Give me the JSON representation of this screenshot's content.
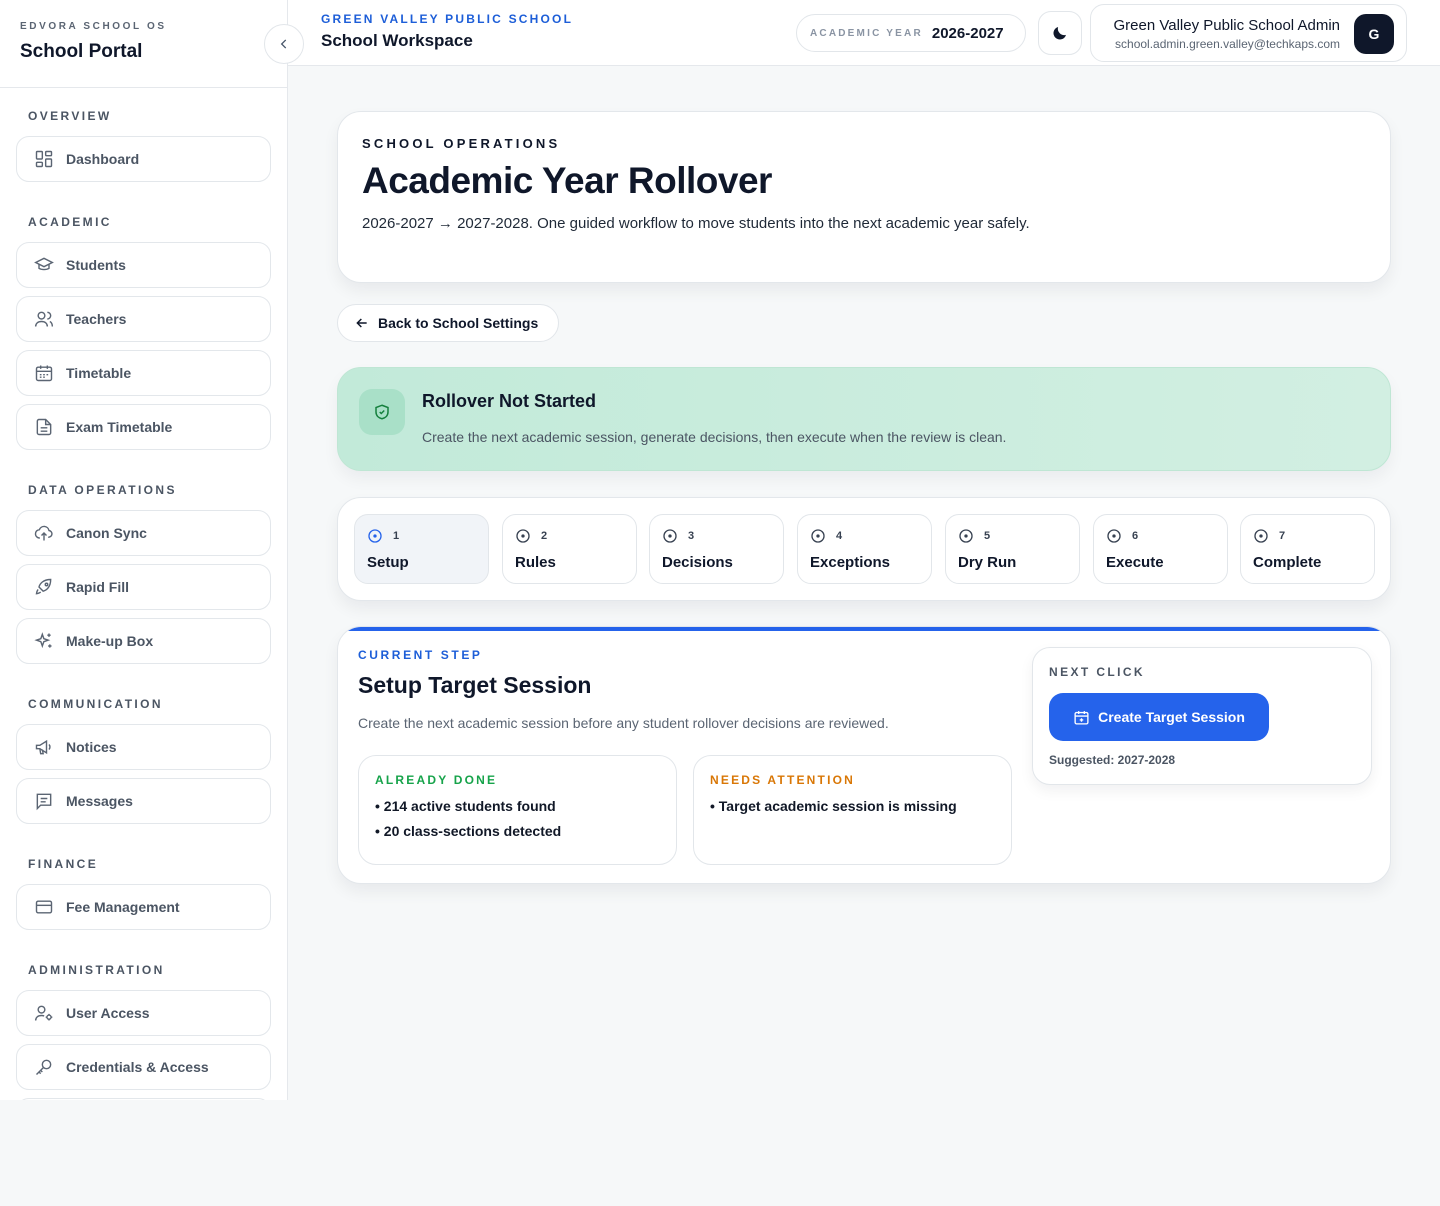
{
  "sidebar": {
    "kicker": "EDVORA SCHOOL OS",
    "title": "School Portal",
    "sections": [
      {
        "label": "OVERVIEW",
        "items": [
          {
            "label": "Dashboard",
            "icon": "dashboard-icon"
          }
        ]
      },
      {
        "label": "ACADEMIC",
        "items": [
          {
            "label": "Students",
            "icon": "graduation-cap-icon"
          },
          {
            "label": "Teachers",
            "icon": "users-icon"
          },
          {
            "label": "Timetable",
            "icon": "calendar-icon"
          },
          {
            "label": "Exam Timetable",
            "icon": "document-icon"
          }
        ]
      },
      {
        "label": "DATA OPERATIONS",
        "items": [
          {
            "label": "Canon Sync",
            "icon": "cloud-upload-icon"
          },
          {
            "label": "Rapid Fill",
            "icon": "rocket-icon"
          },
          {
            "label": "Make-up Box",
            "icon": "sparkles-icon"
          }
        ]
      },
      {
        "label": "COMMUNICATION",
        "items": [
          {
            "label": "Notices",
            "icon": "megaphone-icon"
          },
          {
            "label": "Messages",
            "icon": "message-icon"
          }
        ]
      },
      {
        "label": "FINANCE",
        "items": [
          {
            "label": "Fee Management",
            "icon": "credit-card-icon"
          }
        ]
      },
      {
        "label": "ADMINISTRATION",
        "items": [
          {
            "label": "User Access",
            "icon": "user-gear-icon"
          },
          {
            "label": "Credentials & Access",
            "icon": "key-icon"
          }
        ]
      }
    ]
  },
  "header": {
    "kicker": "GREEN VALLEY PUBLIC SCHOOL",
    "title": "School Workspace",
    "academic_year_label": "ACADEMIC YEAR",
    "academic_year_value": "2026-2027",
    "user_name": "Green Valley Public School Admin",
    "user_email": "school.admin.green.valley@techkaps.com",
    "avatar_letter": "G"
  },
  "hero": {
    "kicker": "SCHOOL OPERATIONS",
    "title": "Academic Year Rollover",
    "description": "2026-2027 → 2027-2028. One guided workflow to move students into the next academic year safely."
  },
  "back_button": "Back to School Settings",
  "status": {
    "title": "Rollover Not Started",
    "description": "Create the next academic session, generate decisions, then execute when the review is clean."
  },
  "steps": [
    {
      "num": "1",
      "label": "Setup",
      "active": true
    },
    {
      "num": "2",
      "label": "Rules"
    },
    {
      "num": "3",
      "label": "Decisions"
    },
    {
      "num": "4",
      "label": "Exceptions"
    },
    {
      "num": "5",
      "label": "Dry Run"
    },
    {
      "num": "6",
      "label": "Execute"
    },
    {
      "num": "7",
      "label": "Complete"
    }
  ],
  "current_step": {
    "kicker": "CURRENT STEP",
    "title": "Setup Target Session",
    "description": "Create the next academic session before any student rollover decisions are reviewed.",
    "done_title": "ALREADY DONE",
    "done_items": [
      "• 214 active students found",
      "• 20 class-sections detected"
    ],
    "attention_title": "NEEDS ATTENTION",
    "attention_items": [
      "• Target academic session is missing"
    ],
    "next_kicker": "NEXT CLICK",
    "cta_label": "Create Target Session",
    "suggested": "Suggested: 2027-2028"
  },
  "colors": {
    "accent": "#2563eb",
    "done": "#16a34a",
    "attention": "#d97706",
    "status_bg": "#c8ecdc"
  }
}
